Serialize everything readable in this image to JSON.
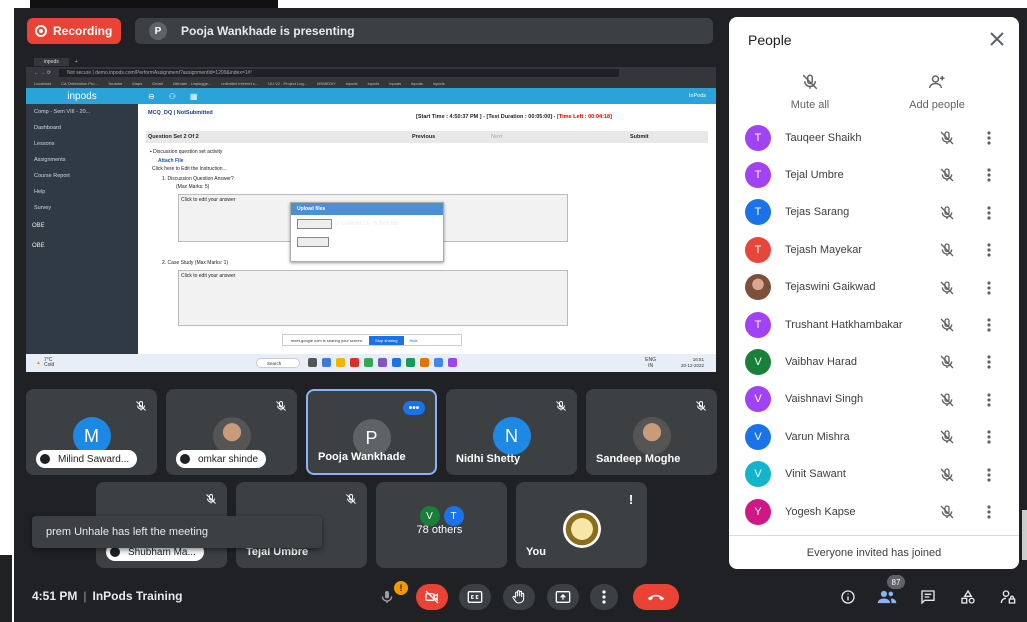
{
  "recording": {
    "label": "Recording"
  },
  "presenting": {
    "initial": "P",
    "text": "Pooja Wankhade is presenting"
  },
  "screen": {
    "browser_tab": "inpods",
    "address": "Not secure | demo.inpods.com/PerformAssignment?assignmentId=1299&index=1#!",
    "bookmarks": [
      "Localhost",
      "CA Orientation Pro...",
      "Youtube",
      "Maps",
      "Gmail",
      "Ultimate - Unplugge...",
      "unlimited internet s...",
      "UU V2 - Project Log...",
      "MSMEDIY",
      "inpods",
      "inpods",
      "inpods",
      "inpods",
      "inpods"
    ],
    "logo": "inpods",
    "course": "Comp - Sem VIII - 20...",
    "side_items": [
      "Dashboard",
      "Lessons",
      "Assignments",
      "Course Report",
      "Help",
      "Survey"
    ],
    "side_heads": [
      "OBE",
      "OBE"
    ],
    "user": "InPods",
    "crumb": "MCQ_DQ | NotSubmitted",
    "time_info": "[Start Time : 4:50:37 PM ] - [Test Duration : 00:05:00] - ",
    "time_left": "[Time Left : 00:04:18]",
    "question_set": "Question Set 2 Of 2",
    "previous": "Previous",
    "next": "Next",
    "submit": "Submit",
    "activity": "Discussion question set activity",
    "attach": "Attach File",
    "instructions": "Click here to Edit the Instruction...",
    "q1": "1.  Discussion Question Answer?",
    "q1_marks": "(Max Marks: 5)",
    "answer_placeholder": "Click to edit your answer",
    "upload_title": "Upload files",
    "choose_file": "Choose File",
    "file_name": "1. Curriculu....h - B.Tech.pdf",
    "upload_btn": "Upload file",
    "q2": "2.  Case Study   (Max Marks: 1)",
    "share_text": "meet.google.com is sharing your screen.",
    "stop_sharing": "Stop sharing",
    "hide": "Hide",
    "weather": "7°C",
    "weather2": "Cold",
    "search": "Search",
    "lang": "ENG",
    "lang2": "IN",
    "clock_time": "16:51",
    "clock_date": "20-12-2022"
  },
  "tiles": [
    {
      "name": "Milind Saward...",
      "initial": "M",
      "color": "#1e88e5",
      "style": "pill"
    },
    {
      "name": "omkar shinde",
      "style": "pill",
      "photo": true
    },
    {
      "name": "Pooja Wankhade",
      "initial": "P",
      "color": "#5f6368",
      "style": "plain",
      "active": true
    },
    {
      "name": "Nidhi Shetty",
      "initial": "N",
      "color": "#1e88e5",
      "style": "plain"
    },
    {
      "name": "Sandeep Moghe",
      "style": "plain",
      "photo": true
    },
    {
      "name": "Shubham Ma...",
      "style": "pill"
    },
    {
      "name": "Tejal Umbre",
      "style": "plain"
    },
    {
      "name": "78 others",
      "style": "others",
      "initials": [
        "V",
        "T"
      ]
    },
    {
      "name": "You",
      "style": "plain"
    }
  ],
  "toast": "prem Unhale has left the meeting",
  "people": {
    "title": "People",
    "mute_all": "Mute all",
    "add_people": "Add people",
    "list": [
      {
        "initial": "T",
        "name": "Tauqeer Shaikh",
        "color": "#a142f4"
      },
      {
        "initial": "T",
        "name": "Tejal Umbre",
        "color": "#a142f4"
      },
      {
        "initial": "T",
        "name": "Tejas Sarang",
        "color": "#1a73e8"
      },
      {
        "initial": "T",
        "name": "Tejash Mayekar",
        "color": "#e8453c"
      },
      {
        "initial": "",
        "name": "Tejaswini Gaikwad",
        "color": "#b07a5a",
        "photo": true
      },
      {
        "initial": "T",
        "name": "Trushant Hatkhambakar",
        "color": "#a142f4"
      },
      {
        "initial": "V",
        "name": "Vaibhav Harad",
        "color": "#188038"
      },
      {
        "initial": "V",
        "name": "Vaishnavi Singh",
        "color": "#a142f4"
      },
      {
        "initial": "V",
        "name": "Varun Mishra",
        "color": "#1a73e8"
      },
      {
        "initial": "V",
        "name": "Vinit Sawant",
        "color": "#12b5cb"
      },
      {
        "initial": "Y",
        "name": "Yogesh Kapse",
        "color": "#d01884"
      }
    ],
    "footer": "Everyone invited has joined"
  },
  "bottom": {
    "time": "4:51 PM",
    "meeting": "InPods Training",
    "participant_count": "87",
    "mic_warning": "!"
  },
  "colors": {
    "background": "#202124",
    "tile": "#3c4043",
    "danger": "#ea4335",
    "accent": "#8ab4f8"
  }
}
